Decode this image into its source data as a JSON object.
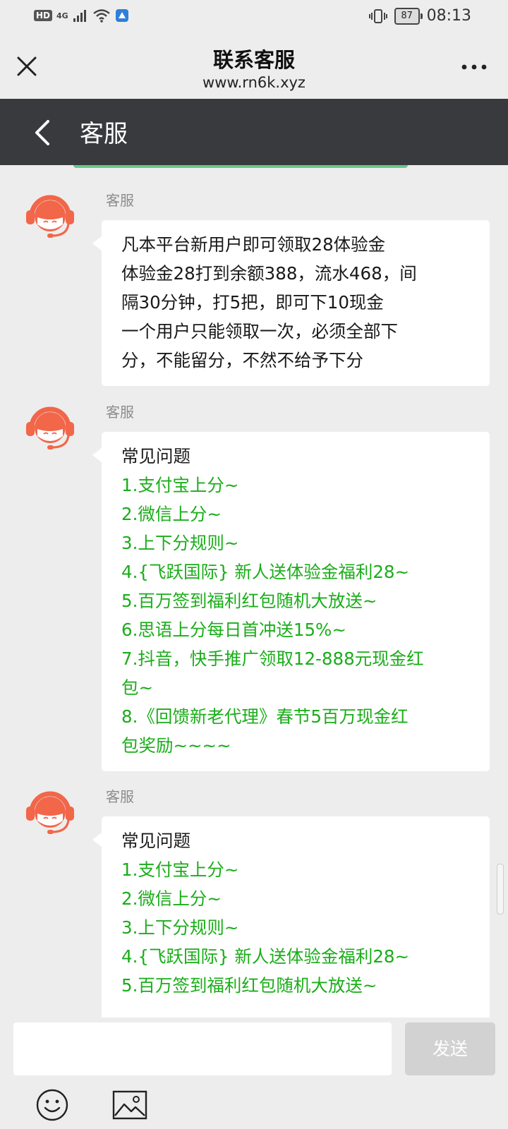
{
  "status_bar": {
    "hd": "HD",
    "network": "4G",
    "battery": "87",
    "time": "08:13"
  },
  "window": {
    "title": "联系客服",
    "url": "www.rn6k.xyz"
  },
  "nav": {
    "title": "客服"
  },
  "messages": [
    {
      "sender": "客服",
      "lines": [
        {
          "text": "凡本平台新用户即可领取28体验金",
          "link": false
        },
        {
          "text": "体验金28打到余额388，流水468，间",
          "link": false
        },
        {
          "text": "隔30分钟，打5把，即可下10现金",
          "link": false
        },
        {
          "text": "一个用户只能领取一次，必须全部下",
          "link": false
        },
        {
          "text": "分，不能留分，不然不给予下分",
          "link": false
        }
      ]
    },
    {
      "sender": "客服",
      "lines": [
        {
          "text": "常见问题",
          "link": false
        },
        {
          "text": "1.支付宝上分~",
          "link": true
        },
        {
          "text": "2.微信上分~",
          "link": true
        },
        {
          "text": "3.上下分规则~",
          "link": true
        },
        {
          "text": "4.{飞跃国际} 新人送体验金福利28~",
          "link": true
        },
        {
          "text": "5.百万签到福利红包随机大放送~",
          "link": true
        },
        {
          "text": "6.思语上分每日首冲送15%~",
          "link": true
        },
        {
          "text": "7.抖音，快手推广领取12-888元现金红",
          "link": true
        },
        {
          "text": "包~",
          "link": true
        },
        {
          "text": "8.《回馈新老代理》春节5百万现金红",
          "link": true
        },
        {
          "text": "包奖励~~~~",
          "link": true
        }
      ]
    },
    {
      "sender": "客服",
      "lines": [
        {
          "text": "常见问题",
          "link": false
        },
        {
          "text": "1.支付宝上分~",
          "link": true
        },
        {
          "text": "2.微信上分~",
          "link": true
        },
        {
          "text": "3.上下分规则~",
          "link": true
        },
        {
          "text": "4.{飞跃国际} 新人送体验金福利28~",
          "link": true
        },
        {
          "text": "5.百万签到福利红包随机大放送~",
          "link": true
        }
      ]
    }
  ],
  "input": {
    "send_label": "发送"
  },
  "colors": {
    "link": "#1aad19",
    "nav_bg": "#393a3e",
    "avatar": "#f26649",
    "send_disabled": "#d2d2d2"
  },
  "icons": [
    "close-icon",
    "more-icon",
    "back-arrow-icon",
    "agent-avatar-icon",
    "emoji-icon",
    "image-icon"
  ]
}
